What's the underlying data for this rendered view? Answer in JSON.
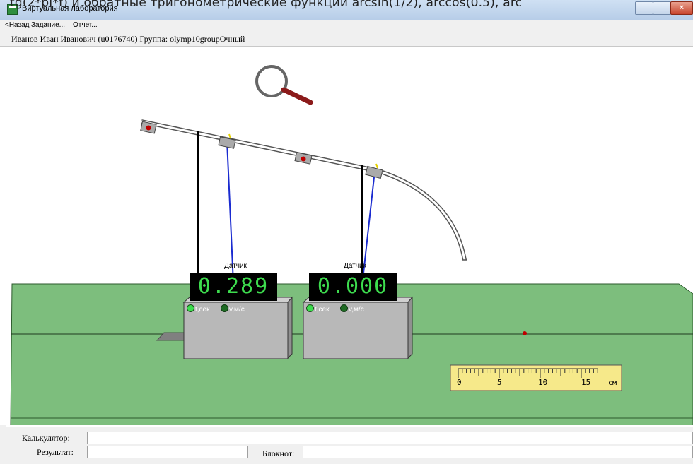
{
  "overlay_text": "tg(2*pi*f) и обратные тригонометрические функции arcsin(1/2), arccos(0.5), arc",
  "window": {
    "title": "Виртуальная лаборатория",
    "close_glyph": "×"
  },
  "menu": {
    "items": [
      "<Назад",
      "Задание...",
      "Отчет..."
    ]
  },
  "user": {
    "info": "Иванов Иван Иванович (u0176740)  Группа: olymp10groupОчный"
  },
  "sensors": [
    {
      "title": "Датчик",
      "value": "0.289",
      "t_label": "t,сек",
      "v_label": "v,м/с"
    },
    {
      "title": "Датчик",
      "value": "0.000",
      "t_label": "t,сек",
      "v_label": "v,м/с"
    }
  ],
  "ruler": {
    "ticks": [
      "0",
      "5",
      "10",
      "15"
    ],
    "unit": "см"
  },
  "bottom": {
    "calculator_label": "Калькулятор:",
    "calculator_value": "",
    "result_label": "Результат:",
    "result_value": "",
    "notepad_label": "Блокнот:",
    "notepad_value": ""
  },
  "colors": {
    "table": "#7dbe7d",
    "lcd_digits": "#3ddc4e",
    "thread": "#1a2bd0"
  }
}
